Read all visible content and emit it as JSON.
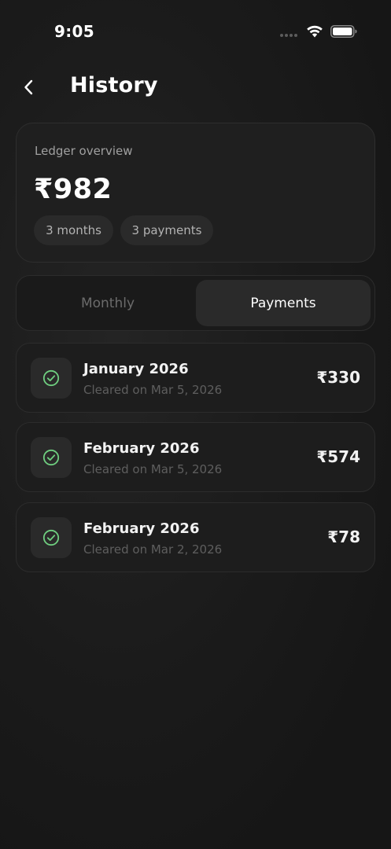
{
  "status_bar": {
    "time": "9:05",
    "icons": [
      "signal-icon",
      "wifi-icon",
      "battery-icon"
    ]
  },
  "header": {
    "back_icon": "chevron-left-icon",
    "title": "History"
  },
  "overview": {
    "label": "Ledger overview",
    "amount": "₹982",
    "chips": [
      "3 months",
      "3 payments"
    ]
  },
  "tabs": {
    "items": [
      "Monthly",
      "Payments"
    ],
    "selected": "Payments"
  },
  "payments": [
    {
      "title": "January 2026",
      "subtitle": "Cleared on Mar 5, 2026",
      "amount": "₹330",
      "icon": "check-circle-icon"
    },
    {
      "title": "February 2026",
      "subtitle": "Cleared on Mar 5, 2026",
      "amount": "₹574",
      "icon": "check-circle-icon"
    },
    {
      "title": "February 2026",
      "subtitle": "Cleared on Mar 2, 2026",
      "amount": "₹78",
      "icon": "check-circle-icon"
    }
  ],
  "colors": {
    "background": "#161616",
    "card": "#1f1f1f",
    "accent_check": "#6fcf80",
    "muted_text": "#5e5e5e"
  }
}
